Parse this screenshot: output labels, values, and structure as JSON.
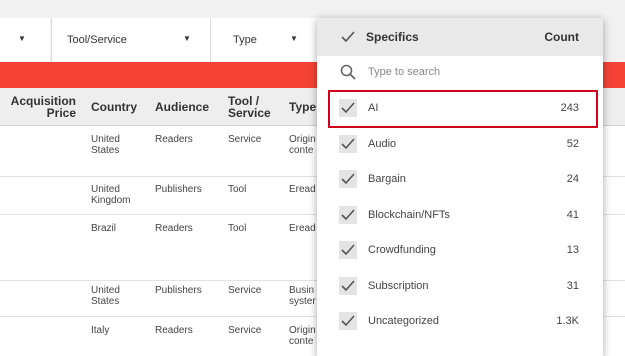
{
  "filters": [
    {
      "label": ""
    },
    {
      "label": "Tool/Service"
    },
    {
      "label": "Type"
    }
  ],
  "table": {
    "headers": {
      "acquisition_price": [
        "Acquisition",
        "Price"
      ],
      "country": "Country",
      "audience": "Audience",
      "tool_service": [
        "Tool /",
        "Service"
      ],
      "type": "Type"
    },
    "rows": [
      {
        "country": [
          "United",
          "States"
        ],
        "audience": "Readers",
        "tool": "Service",
        "type": [
          "Origin",
          "conte"
        ]
      },
      {
        "country": [
          "United",
          "Kingdom"
        ],
        "audience": "Publishers",
        "tool": "Tool",
        "type": [
          "Eread",
          ""
        ]
      },
      {
        "country": [
          "Brazil",
          ""
        ],
        "audience": "Readers",
        "tool": "Tool",
        "type": [
          "Eread",
          ""
        ]
      },
      {
        "country": [
          "United",
          "States"
        ],
        "audience": "Publishers",
        "tool": "Service",
        "type": [
          "Busin",
          "syster"
        ]
      },
      {
        "country": [
          "Italy",
          ""
        ],
        "audience": "Readers",
        "tool": "Service",
        "type": [
          "Origin",
          "conte"
        ]
      }
    ]
  },
  "dropdown": {
    "title": "Specifics",
    "count_header": "Count",
    "search_placeholder": "Type to search",
    "items": [
      {
        "label": "AI",
        "count": "243"
      },
      {
        "label": "Audio",
        "count": "52"
      },
      {
        "label": "Bargain",
        "count": "24"
      },
      {
        "label": "Blockchain/NFTs",
        "count": "41"
      },
      {
        "label": "Crowdfunding",
        "count": "13"
      },
      {
        "label": "Subscription",
        "count": "31"
      },
      {
        "label": "Uncategorized",
        "count": "1.3K"
      }
    ]
  },
  "colors": {
    "accent_red": "#f44336",
    "highlight": "#d0021b"
  }
}
